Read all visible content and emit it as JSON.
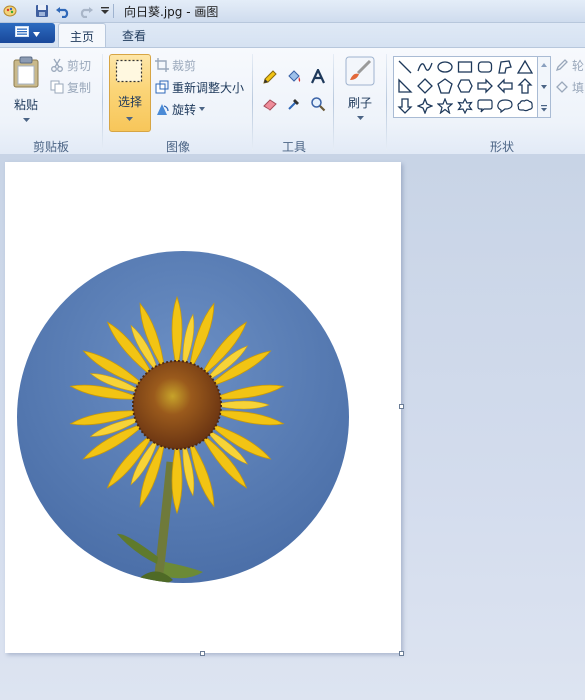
{
  "window": {
    "title": "向日葵.jpg - 画图"
  },
  "tabs": [
    {
      "label": "主页"
    },
    {
      "label": "查看"
    }
  ],
  "ribbon": {
    "clipboard": {
      "label": "剪贴板",
      "paste_label": "粘贴",
      "cut_label": "剪切",
      "copy_label": "复制"
    },
    "image": {
      "label": "图像",
      "select_label": "选择",
      "crop_label": "裁剪",
      "resize_label": "重新调整大小",
      "rotate_label": "旋转"
    },
    "tools": {
      "label": "工具"
    },
    "brushes": {
      "label": "刷子"
    },
    "shapes": {
      "label": "形状",
      "outline_label": "轮",
      "fill_label": "填"
    }
  },
  "colors": {
    "sky_blue": "#5b7fb6",
    "petal_yellow": "#f2c414",
    "center_brown": "#8a4d1a",
    "select_highlight": "#fbd578"
  }
}
